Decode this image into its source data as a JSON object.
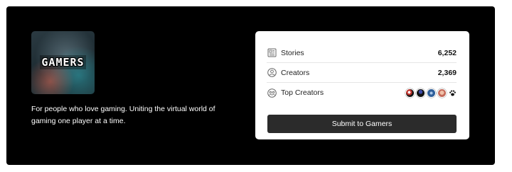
{
  "publication": {
    "logo_text": "GAMERS",
    "description": "For people who love gaming. Uniting the virtual world of gaming one player at a time."
  },
  "stats": [
    {
      "label": "Stories",
      "value": "6,252",
      "icon": "newspaper-icon"
    },
    {
      "label": "Creators",
      "value": "2,369",
      "icon": "user-circle-icon"
    },
    {
      "label": "Top Creators",
      "icon": "group-icon"
    }
  ],
  "top_creators": [
    "creator-avatar",
    "creator-avatar",
    "creator-avatar",
    "creator-avatar",
    "paw-icon"
  ],
  "submit": {
    "label": "Submit to Gamers"
  },
  "colors": {
    "banner": "#000000",
    "card": "#ffffff",
    "button": "#2b2b2b"
  }
}
